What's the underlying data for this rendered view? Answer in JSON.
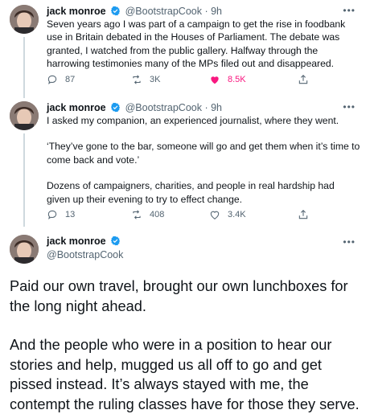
{
  "tweets": [
    {
      "name": "jack monroe",
      "handle": "@BootstrapCook · 9h",
      "text": "Seven years ago I was part of a campaign to get the rise in foodbank use in Britain debated in the Houses of Parliament. The debate was granted, I watched from the public gallery. Halfway through the harrowing testimonies many of the MPs filed out and disappeared.",
      "replies": "87",
      "retweets": "3K",
      "likes": "8.5K",
      "liked": true
    },
    {
      "name": "jack monroe",
      "handle": "@BootstrapCook · 9h",
      "paragraphs": [
        "I asked my companion, an experienced journalist, where they went.",
        "‘They’ve gone to the bar, someone will go and get them when it’s time to come back and vote.’",
        "Dozens of campaigners, charities, and people in real hardship had given up their evening to try to effect change."
      ],
      "replies": "13",
      "retweets": "408",
      "likes": "3.4K",
      "liked": false
    },
    {
      "name": "jack monroe",
      "handle": "@BootstrapCook",
      "paragraphs": [
        "Paid our own travel, brought our own lunchboxes for the long night ahead.",
        "And the people who were in a position to hear our stories and help, mugged us all off to go and get pissed instead. It’s always stayed with me, the contempt the ruling classes have for those they serve."
      ]
    }
  ],
  "icons": {
    "verified": "verified-badge-icon",
    "more": "more-icon",
    "reply": "reply-icon",
    "retweet": "retweet-icon",
    "like": "heart-icon",
    "share": "share-icon"
  },
  "colors": {
    "verified": "#1d9bf0",
    "like_active": "#f91880",
    "secondary_text": "#536471"
  }
}
